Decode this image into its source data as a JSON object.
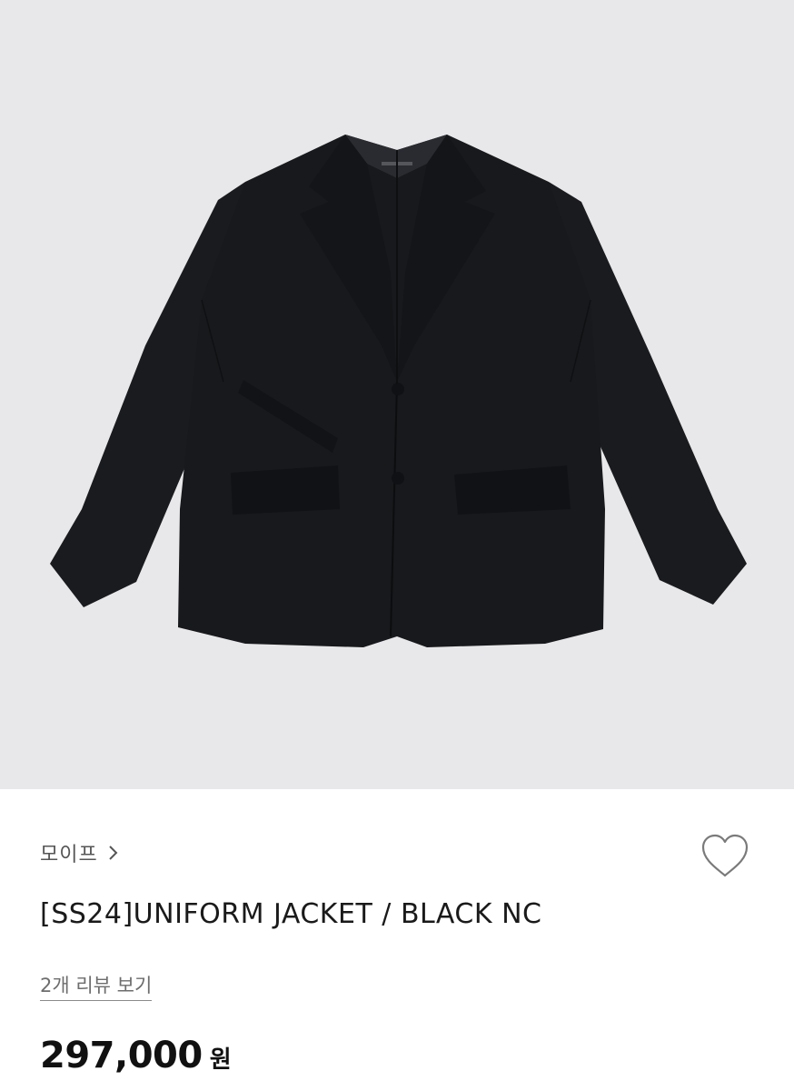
{
  "product": {
    "brand": "모이프",
    "title": "[SS24]UNIFORM JACKET / BLACK NC",
    "review_link": "2개 리뷰 보기",
    "price": "297,000",
    "currency": "원"
  },
  "icons": {
    "brand_chevron": "chevron-right-icon",
    "wishlist": "heart-outline-icon"
  },
  "colors": {
    "image_background": "#e8e8ea",
    "jacket": "#17181b"
  }
}
